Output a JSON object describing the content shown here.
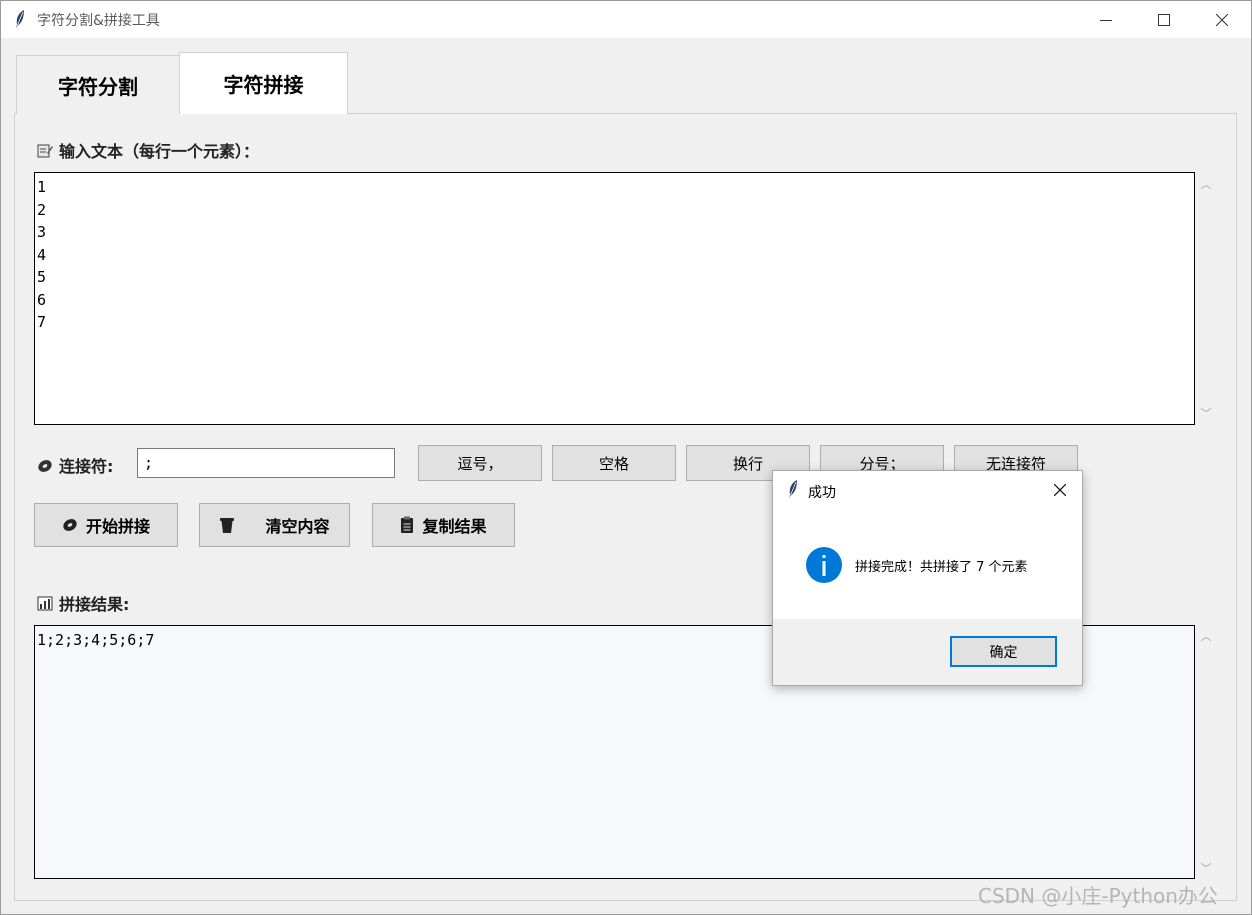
{
  "window": {
    "title": "字符分割&拼接工具",
    "icon": "feather-icon",
    "controls": [
      "minimize-icon",
      "maximize-icon",
      "close-icon"
    ]
  },
  "tabs": [
    {
      "label": "字符分割",
      "active": false
    },
    {
      "label": "字符拼接",
      "active": true
    }
  ],
  "input_section": {
    "label": "输入文本（每行一个元素）：",
    "lines": "1\n2\n3\n4\n5\n6\n7"
  },
  "separator": {
    "label": "连接符:",
    "value": ";",
    "presets": [
      "逗号，",
      "空格",
      "换行",
      "分号；",
      "无连接符"
    ]
  },
  "actions": {
    "start": "开始拼接",
    "clear": "清空内容",
    "copy": "复制结果"
  },
  "result_section": {
    "label": "拼接结果:",
    "value": "1;2;3;4;5;6;7"
  },
  "dialog": {
    "title": "成功",
    "message": "拼接完成！共拼接了 7 个元素",
    "ok_label": "确定",
    "accent_color": "#0078d7"
  },
  "watermark": "CSDN @小庄-Python办公"
}
